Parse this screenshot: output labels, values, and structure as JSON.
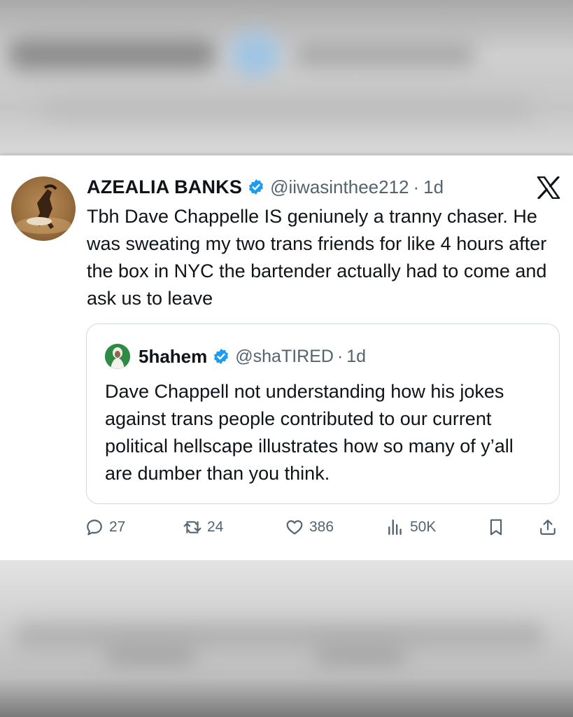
{
  "tweet": {
    "display_name": "AZEALIA BANKS",
    "handle": "@iiwasinthee212",
    "separator": "·",
    "time": "1d",
    "text": "Tbh Dave Chappelle IS geniunely a tranny chaser. He was sweating my two trans friends for like 4 hours after the box in NYC the bartender actually had to come and ask us to leave",
    "avatar_icon": "profile-photo",
    "verified_icon": "verified-badge-icon",
    "platform_icon": "x-logo-icon"
  },
  "quoted_tweet": {
    "display_name": "5hahem",
    "handle": "@shaTIRED",
    "separator": "·",
    "time": "1d",
    "text": "Dave Chappell not understanding how his jokes against trans people contributed to our current political hellscape illustrates how so many of y’all are dumber than you think."
  },
  "actions": {
    "replies": "27",
    "reposts": "24",
    "likes": "386",
    "views": "50K"
  },
  "colors": {
    "text": "#0f1419",
    "secondary": "#536471",
    "verified": "#1d9bf0",
    "border": "#cfd9de"
  }
}
